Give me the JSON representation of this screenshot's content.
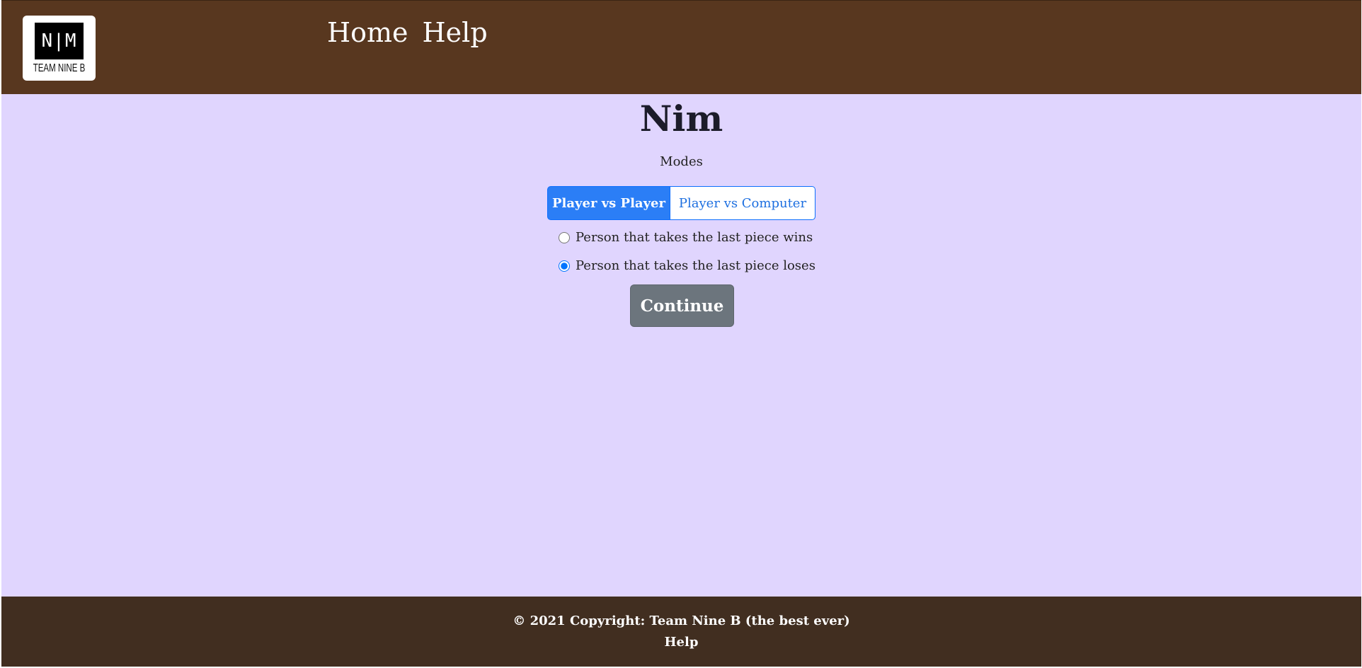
{
  "header": {
    "logo": {
      "mark": "N|M",
      "subtitle": "TEAM NINE B"
    },
    "nav": [
      {
        "label": "Home"
      },
      {
        "label": "Help"
      }
    ]
  },
  "main": {
    "title": "Nim",
    "modes_label": "Modes",
    "mode_buttons": [
      {
        "label": "Player vs Player",
        "selected": true
      },
      {
        "label": "Player vs Computer",
        "selected": false
      }
    ],
    "rules": [
      {
        "label": "Person that takes the last piece wins",
        "checked": false
      },
      {
        "label": "Person that takes the last piece loses",
        "checked": true
      }
    ],
    "continue_label": "Continue"
  },
  "footer": {
    "copyright": "© 2021 Copyright: Team Nine B (the best ever)",
    "help_link": "Help"
  },
  "colors": {
    "header_bg": "#58371f",
    "main_bg": "#e0d5fe",
    "footer_bg": "#412e20",
    "primary": "#2b7ef6",
    "secondary_button": "#6c757d"
  }
}
